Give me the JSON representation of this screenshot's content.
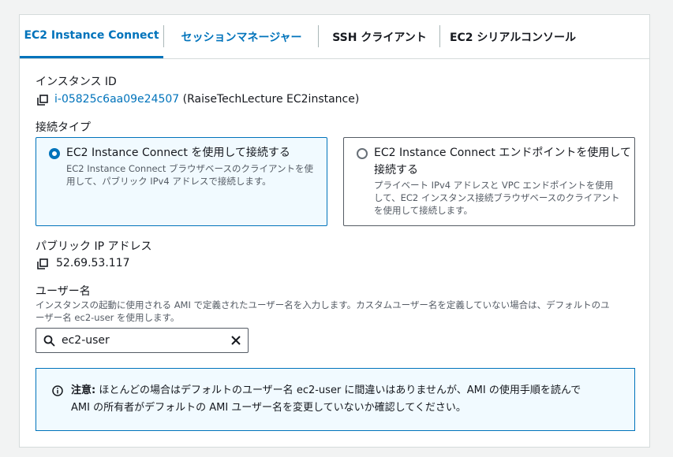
{
  "tabs": [
    {
      "label": "EC2 Instance Connect"
    },
    {
      "label": "セッションマネージャー"
    },
    {
      "label": "SSH クライアント"
    },
    {
      "label": "EC2 シリアルコンソール"
    }
  ],
  "instance": {
    "label": "インスタンス ID",
    "id": "i-05825c6aa09e24507",
    "name": "(RaiseTechLecture EC2instance)"
  },
  "connection_type": {
    "label": "接続タイプ",
    "options": [
      {
        "title": "EC2 Instance Connect を使用して接続する",
        "desc_lines": [
          "EC2 Instance Connect ブラウザベースのクライアントを使",
          "用して、パブリック IPv4 アドレスで接続します。"
        ],
        "selected": true
      },
      {
        "title_lines": [
          "EC2 Instance Connect エンドポイントを使用して",
          "接続する"
        ],
        "desc_lines": [
          "プライベート IPv4 アドレスと VPC エンドポイントを使用",
          "して、EC2 インスタンス接続ブラウザベースのクライアント",
          "を使用して接続します。"
        ],
        "selected": false
      }
    ]
  },
  "public_ip": {
    "label": "パブリック IP アドレス",
    "value": "52.69.53.117"
  },
  "username": {
    "label": "ユーザー名",
    "desc_lines": [
      "インスタンスの起動に使用される AMI で定義されたユーザー名を入力します。カスタムユーザー名を定義していない場合は、デフォルトのユ",
      "ーザー名 ec2-user を使用します。"
    ],
    "value": "ec2-user"
  },
  "alert": {
    "bold": "注意:",
    "line1": " ほとんどの場合はデフォルトのユーザー名 ec2-user に間違いはありませんが、AMI の使用手順を読んで",
    "line2": "AMI の所有者がデフォルトの AMI ユーザー名を変更していないか確認してください。"
  },
  "colors": {
    "accent": "#0073bb",
    "selected_bg": "#f1faff"
  }
}
